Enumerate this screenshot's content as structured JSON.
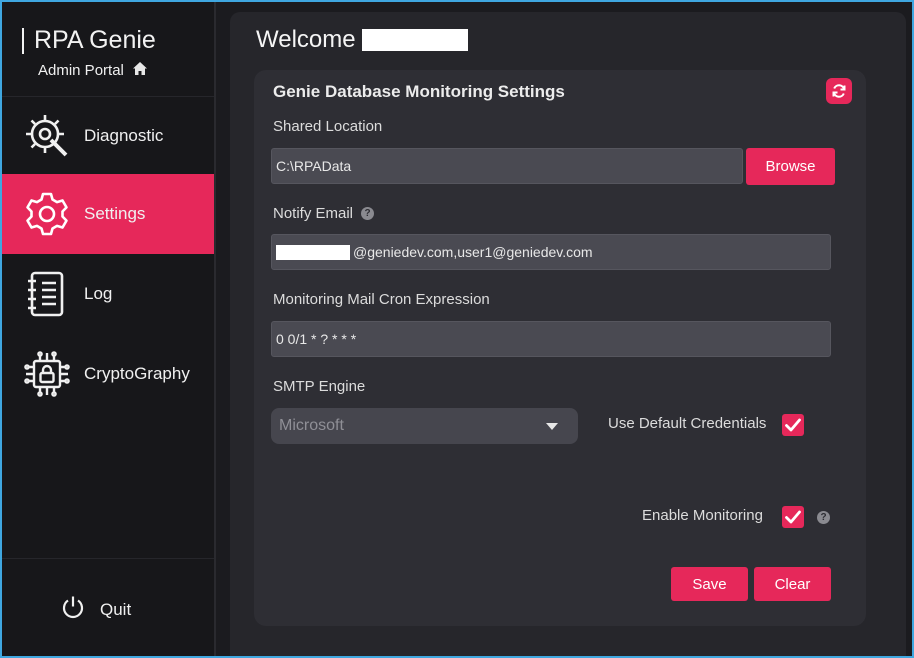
{
  "sidebar": {
    "brand_title": "RPA Genie",
    "brand_subtitle": "Admin Portal",
    "items": [
      {
        "label": "Diagnostic",
        "icon": "gear-wrench-icon",
        "active": false
      },
      {
        "label": "Settings",
        "icon": "gear-icon",
        "active": true
      },
      {
        "label": "Log",
        "icon": "notebook-icon",
        "active": false
      },
      {
        "label": "CryptoGraphy",
        "icon": "circuit-lock-icon",
        "active": false
      }
    ],
    "quit_label": "Quit"
  },
  "header": {
    "welcome": "Welcome"
  },
  "settings_card": {
    "title": "Genie Database Monitoring Settings",
    "shared_location": {
      "label": "Shared Location",
      "value": "C:\\RPAData",
      "browse_label": "Browse"
    },
    "notify_email": {
      "label": "Notify Email",
      "value": "@geniedev.com,user1@geniedev.com"
    },
    "cron": {
      "label": "Monitoring Mail Cron Expression",
      "value": "0 0/1 * ? * * *"
    },
    "smtp": {
      "label": "SMTP Engine",
      "selected": "Microsoft"
    },
    "use_default_credentials": {
      "label": "Use Default Credentials",
      "checked": true
    },
    "enable_monitoring": {
      "label": "Enable Monitoring",
      "checked": true
    },
    "save_label": "Save",
    "clear_label": "Clear"
  },
  "colors": {
    "accent": "#e6285a",
    "sidebar_bg": "#17171a",
    "main_bg": "#26262b",
    "card_bg": "#2e2e34",
    "field_bg": "#4a4a52",
    "frame_border": "#3fa7e0"
  }
}
